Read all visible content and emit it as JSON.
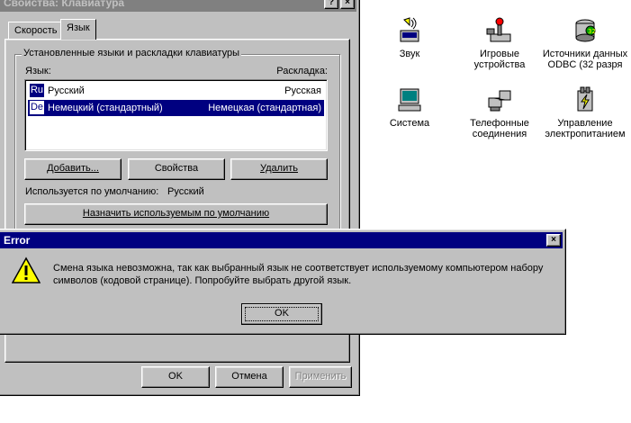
{
  "props_window": {
    "title": "Свойства: Клавиатура",
    "title_help": "?",
    "title_close": "×",
    "tabs": [
      "Скорость",
      "Язык"
    ],
    "group_title": "Установленные языки и раскладки клавиатуры",
    "col_language": "Язык:",
    "col_layout": "Раскладка:",
    "languages": [
      {
        "code": "Ru",
        "name": "Русский",
        "layout": "Русская",
        "selected": false
      },
      {
        "code": "De",
        "name": "Немецкий (стандартный)",
        "layout": "Немецкая (стандартная)",
        "selected": true
      }
    ],
    "add_button": "Добавить...",
    "properties_button": "Свойства",
    "remove_button": "Удалить",
    "default_label": "Используется по умолчанию:",
    "default_value": "Русский",
    "set_default_button": "Назначить используемым по умолчанию",
    "ok_button": "OK",
    "cancel_button": "Отмена",
    "apply_button": "Применить"
  },
  "desktop_icons": [
    {
      "label": "Звук",
      "icon": "speaker-icon"
    },
    {
      "label": "Игровые устройства",
      "icon": "joystick-icon"
    },
    {
      "label": "Источники данных ODBC (32 разря",
      "icon": "odbc-icon"
    },
    {
      "label": "Система",
      "icon": "computer-icon"
    },
    {
      "label": "Телефонные соединения",
      "icon": "telephony-icon"
    },
    {
      "label": "Управление электропитанием",
      "icon": "power-icon"
    }
  ],
  "error_dialog": {
    "title": "Error",
    "close": "×",
    "message": "Смена языка невозможна, так как выбранный язык не соответствует используемому компьютером набору символов (кодовой странице). Попробуйте выбрать другой язык.",
    "ok_button": "OK",
    "icon": "warning-icon"
  },
  "colors": {
    "face": "#c0c0c0",
    "title_active": "#000080",
    "title_inactive": "#808080",
    "selection": "#000080"
  }
}
